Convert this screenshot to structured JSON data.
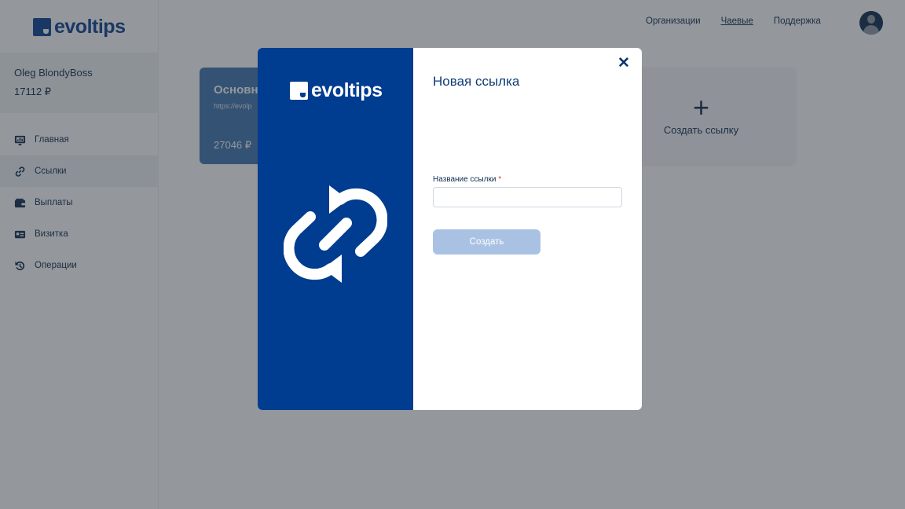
{
  "brand": {
    "name": "evoltips"
  },
  "user": {
    "name": "Oleg BlondyBoss",
    "balance": "17112 ₽"
  },
  "sidebar": {
    "items": [
      {
        "label": "Главная",
        "icon": "dashboard-icon"
      },
      {
        "label": "Ссылки",
        "icon": "link-icon"
      },
      {
        "label": "Выплаты",
        "icon": "wallet-icon"
      },
      {
        "label": "Визитка",
        "icon": "id-card-icon"
      },
      {
        "label": "Операции",
        "icon": "history-icon"
      }
    ]
  },
  "header": {
    "nav": [
      "Организации",
      "Чаевые",
      "Поддержка"
    ],
    "active": "Чаевые"
  },
  "cards": {
    "main": {
      "title": "Основн",
      "url": "https://evolp",
      "amount": "27046 ₽"
    },
    "add": {
      "label": "Создать ссылку"
    }
  },
  "modal": {
    "title": "Новая ссылка",
    "field_label": "Название ссылки",
    "required_mark": "*",
    "input_value": "",
    "submit_label": "Создать",
    "close_icon": "close-icon"
  },
  "colors": {
    "brand": "#0a4193",
    "modal_side": "#003c8f",
    "button_disabled": "#a9c2e4",
    "required": "#e0362c"
  }
}
